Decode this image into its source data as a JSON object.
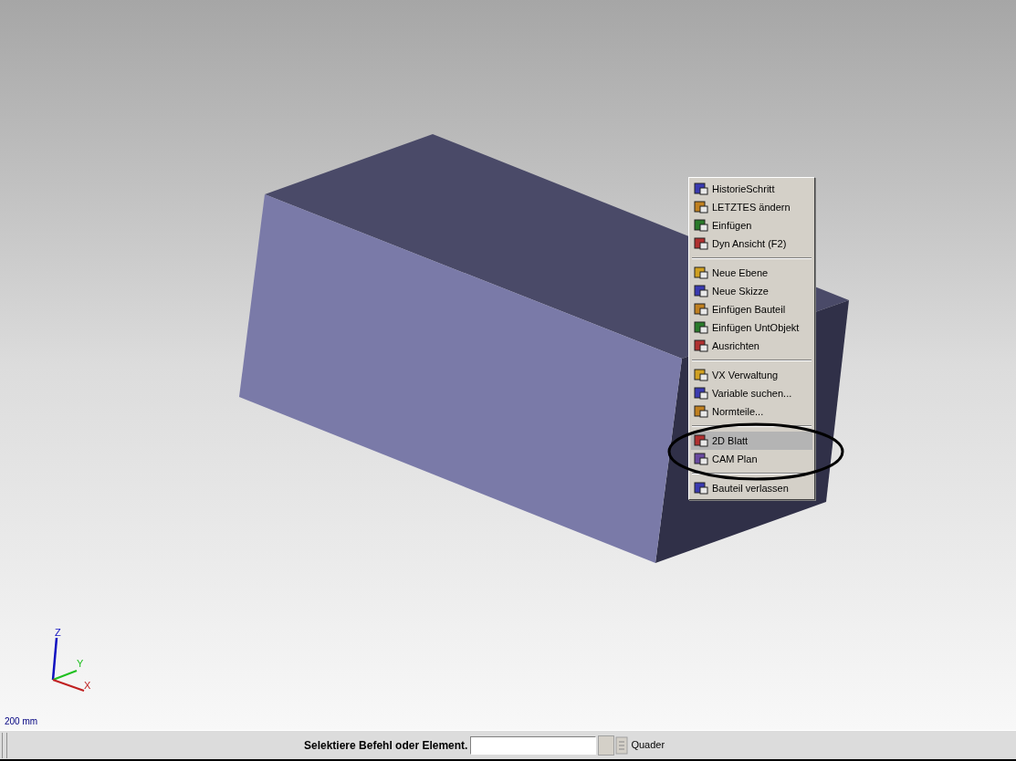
{
  "viewport": {
    "axes": {
      "z": "Z",
      "y": "Y",
      "x": "X"
    },
    "scale": "200 mm"
  },
  "context_menu": {
    "items": [
      {
        "kind": "item",
        "label": "HistorieSchritt",
        "selected": false
      },
      {
        "kind": "item",
        "label": "LETZTES ändern",
        "selected": false
      },
      {
        "kind": "item",
        "label": "Einfügen",
        "selected": false
      },
      {
        "kind": "item",
        "label": "Dyn Ansicht (F2)",
        "selected": false
      },
      {
        "kind": "separator"
      },
      {
        "kind": "item",
        "label": "Neue Ebene",
        "selected": false
      },
      {
        "kind": "item",
        "label": "Neue Skizze",
        "selected": false
      },
      {
        "kind": "item",
        "label": "Einfügen Bauteil",
        "selected": false
      },
      {
        "kind": "item",
        "label": "Einfügen UntObjekt",
        "selected": false
      },
      {
        "kind": "item",
        "label": "Ausrichten",
        "selected": false
      },
      {
        "kind": "separator"
      },
      {
        "kind": "item",
        "label": "VX Verwaltung",
        "selected": false
      },
      {
        "kind": "item",
        "label": "Variable suchen...",
        "selected": false
      },
      {
        "kind": "item",
        "label": "Normteile...",
        "selected": false
      },
      {
        "kind": "separator"
      },
      {
        "kind": "item",
        "label": "2D Blatt",
        "selected": true
      },
      {
        "kind": "item",
        "label": "CAM Plan",
        "selected": false
      },
      {
        "kind": "separator"
      },
      {
        "kind": "item",
        "label": "Bauteil verlassen",
        "selected": false
      }
    ]
  },
  "status_bar": {
    "prompt": "Selektiere Befehl oder Element.",
    "mode": "Quader"
  }
}
